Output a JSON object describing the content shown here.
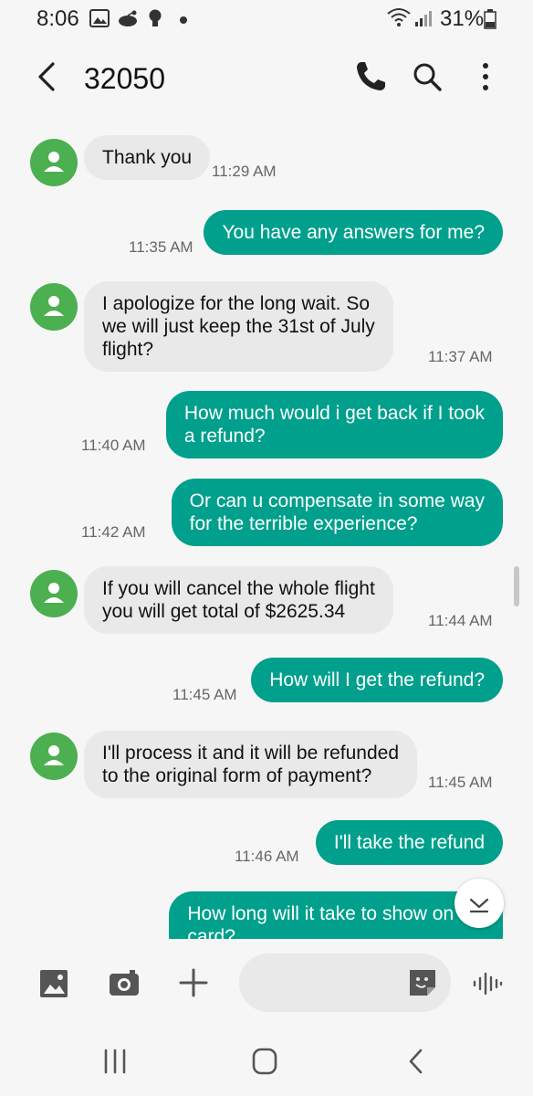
{
  "status_bar": {
    "time": "8:06",
    "battery": "31%",
    "icons": [
      "gallery-icon",
      "reddit-icon",
      "bulb-icon",
      "dot-icon",
      "wifi-icon",
      "signal-icon",
      "battery-icon"
    ]
  },
  "header": {
    "title": "32050",
    "icons": [
      "back-arrow-icon",
      "phone-icon",
      "search-icon",
      "more-vert-icon"
    ]
  },
  "messages": [
    {
      "direction": "in",
      "lines": [
        "Thank you"
      ],
      "time": "11:29 AM"
    },
    {
      "direction": "out",
      "lines": [
        "You have any answers for me?"
      ],
      "time": "11:35 AM"
    },
    {
      "direction": "in",
      "lines": [
        "I apologize for the long wait. So",
        "we will just keep the 31st of July",
        "flight?"
      ],
      "time": "11:37 AM"
    },
    {
      "direction": "out",
      "lines": [
        "How much would i get back if I took",
        "a refund?"
      ],
      "time": "11:40 AM"
    },
    {
      "direction": "out",
      "lines": [
        "Or can u compensate in some way",
        "for the terrible experience?"
      ],
      "time": "11:42 AM"
    },
    {
      "direction": "in",
      "lines": [
        "If you will cancel the whole flight",
        "you will get total of $2625.34"
      ],
      "time": "11:44 AM"
    },
    {
      "direction": "out",
      "lines": [
        "How will I get the refund?"
      ],
      "time": "11:45 AM"
    },
    {
      "direction": "in",
      "lines": [
        "I'll process it and it will be refunded",
        "to the original form of payment?"
      ],
      "time": "11:45 AM"
    },
    {
      "direction": "out",
      "lines": [
        "I'll take the refund"
      ],
      "time": "11:46 AM"
    },
    {
      "direction": "out",
      "lines": [
        "How long will it take to show on my",
        "card?"
      ],
      "time": ""
    }
  ],
  "composer": {
    "placeholder": "",
    "icons": [
      "gallery-icon",
      "camera-icon",
      "plus-icon",
      "sticker-icon",
      "voice-icon"
    ]
  },
  "navbar": {
    "icons": [
      "recents-icon",
      "home-icon",
      "back-icon"
    ]
  },
  "colors": {
    "outgoing_bubble": "#00a08c",
    "incoming_bubble": "#e9e9e9",
    "avatar": "#4caf50",
    "background": "#f6f6f6"
  }
}
